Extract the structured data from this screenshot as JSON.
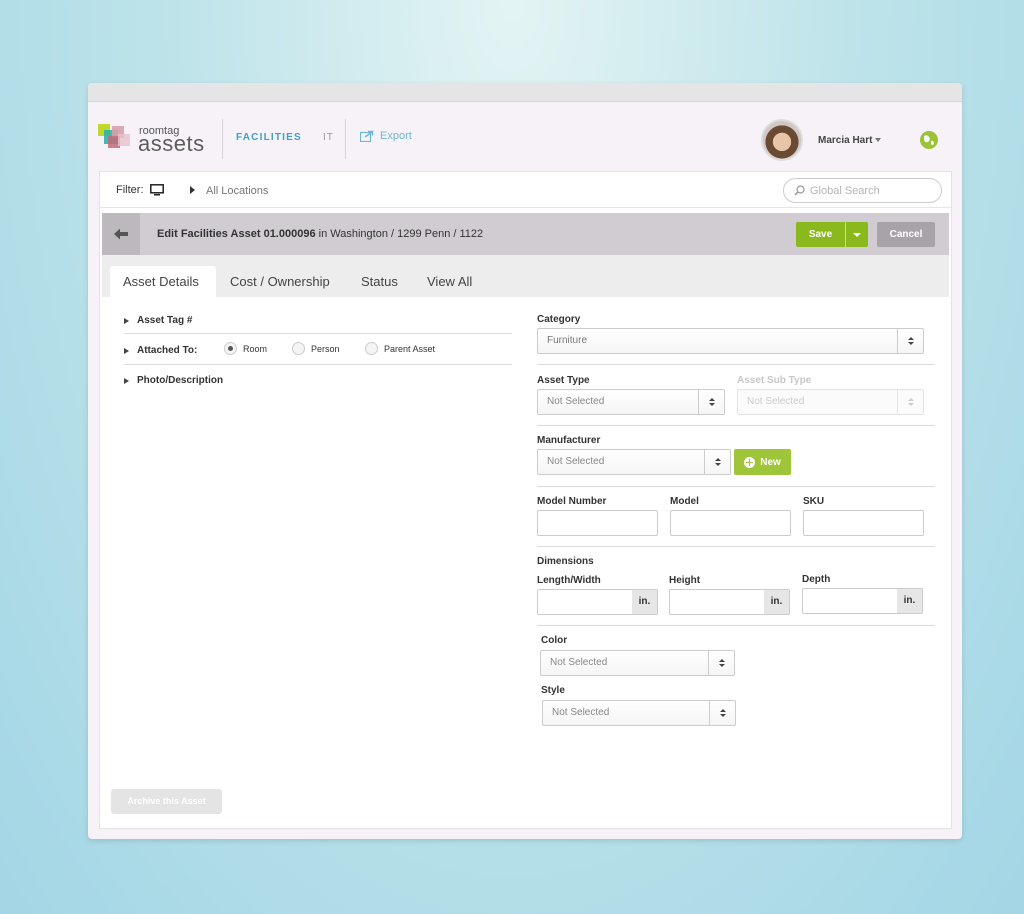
{
  "header": {
    "logo_small": "roomtag",
    "logo_big": "assets",
    "nav": {
      "facilities": "FACILITIES",
      "it": "IT",
      "export": "Export"
    },
    "user": {
      "name": "Marcia Hart"
    }
  },
  "filterbar": {
    "filter_label": "Filter:",
    "location": "All Locations",
    "search_placeholder": "Global Search"
  },
  "editbar": {
    "title_bold": "Edit Facilities Asset 01.000096",
    "title_rest": " in Washington / 1299 Penn / 1122",
    "save_label": "Save",
    "cancel_label": "Cancel"
  },
  "tabs": [
    "Asset Details",
    "Cost / Ownership",
    "Status",
    "View All"
  ],
  "left": {
    "asset_tag": "Asset Tag #",
    "attached_to": "Attached To:",
    "radio_options": [
      "Room",
      "Person",
      "Parent Asset"
    ],
    "selected_radio": "Room",
    "photo_description": "Photo/Description",
    "archive_label": "Archive this Asset"
  },
  "right": {
    "category": {
      "label": "Category",
      "value": "Furniture"
    },
    "asset_type": {
      "label": "Asset Type",
      "value": "Not Selected"
    },
    "asset_sub_type": {
      "label": "Asset Sub Type",
      "value": "Not Selected"
    },
    "manufacturer": {
      "label": "Manufacturer",
      "value": "Not Selected",
      "new_label": "New"
    },
    "model_number": {
      "label": "Model Number",
      "value": ""
    },
    "model": {
      "label": "Model",
      "value": ""
    },
    "sku": {
      "label": "SKU",
      "value": ""
    },
    "dimensions": {
      "label": "Dimensions",
      "length_width": "Length/Width",
      "height": "Height",
      "depth": "Depth",
      "unit": "in."
    },
    "color": {
      "label": "Color",
      "value": "Not Selected"
    },
    "style": {
      "label": "Style",
      "value": "Not Selected"
    }
  },
  "colors": {
    "accent_blue": "#3aa3c2",
    "save_green": "#8ab91d",
    "new_green": "#9fc63a",
    "cancel_gray": "#a7a3a8"
  },
  "icons": [
    "logo-icon",
    "export-icon",
    "caret-down-icon",
    "globe-icon",
    "monitor-icon",
    "triangle-right-icon",
    "search-icon",
    "back-arrow-icon",
    "plus-circle-icon",
    "select-arrows-icon"
  ]
}
